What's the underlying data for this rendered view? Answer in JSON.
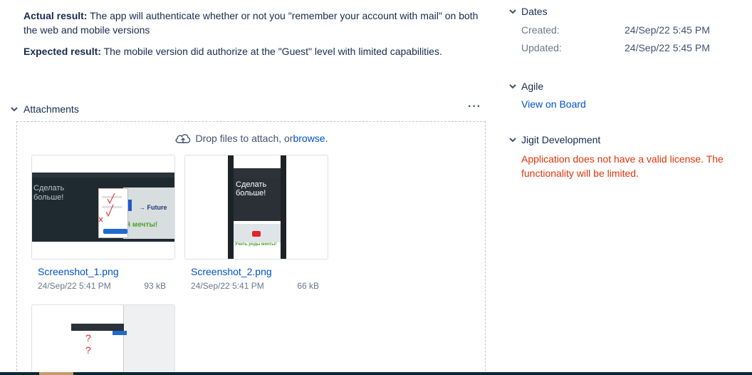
{
  "description": {
    "actual_label": "Actual result:",
    "actual_text": " The app will authenticate whether or not you \"remember your account with mail\" on both the web and mobile versions",
    "expected_label": "Expected result:",
    "expected_text": " The mobile version did authorize at the \"Guest\" level with limited capabilities."
  },
  "attachments": {
    "title": "Attachments",
    "more_label": "···",
    "drop_text": "Drop files to attach, or ",
    "browse_label": "browse.",
    "files": [
      {
        "name": "Screenshot_1.png",
        "date": "24/Sep/22 5:41 PM",
        "size": "93 kB"
      },
      {
        "name": "Screenshot_2.png",
        "date": "24/Sep/22 5:41 PM",
        "size": "66 kB"
      }
    ],
    "thumb1": {
      "left_text": "Сделать больше!",
      "future": "→ Future",
      "green": "й мечты!"
    },
    "thumb2": {
      "hero_text": "Сделать больше!",
      "green": "Учить роды мечты!"
    },
    "thumb3": {
      "mark1": "?",
      "mark2": "?"
    }
  },
  "sidebar": {
    "dates": {
      "title": "Dates",
      "created_label": "Created:",
      "created_value": "24/Sep/22 5:45 PM",
      "updated_label": "Updated:",
      "updated_value": "24/Sep/22 5:45 PM"
    },
    "agile": {
      "title": "Agile",
      "link": "View on Board"
    },
    "jigit": {
      "title": "Jigit Development",
      "error": "Application does not have a valid license. The functionality will be limited."
    }
  },
  "colors": {
    "link": "#0052cc",
    "error": "#de350b",
    "text": "#172b4d"
  }
}
